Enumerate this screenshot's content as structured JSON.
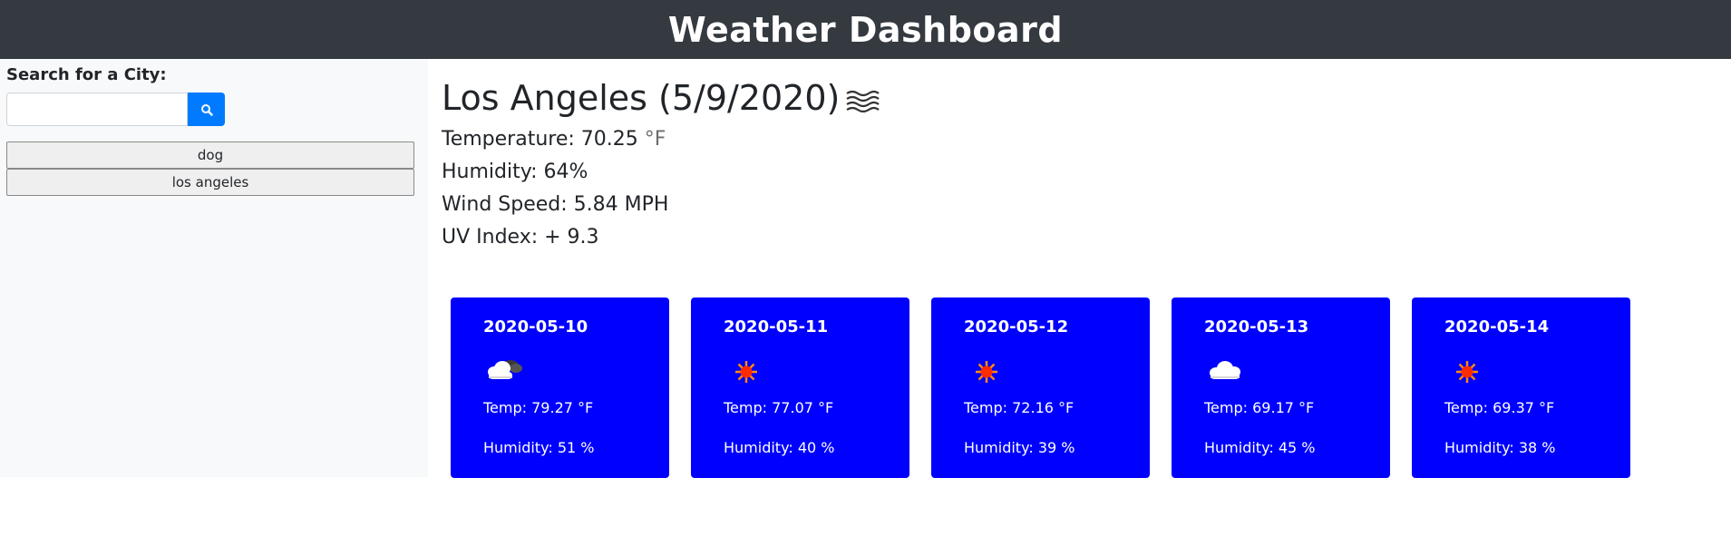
{
  "header": {
    "title": "Weather Dashboard"
  },
  "sidebar": {
    "search_label": "Search for a City:",
    "search_value": "",
    "search_placeholder": "",
    "search_button_icon": "search-icon",
    "history": [
      "dog",
      "los angeles"
    ]
  },
  "current": {
    "title": "Los Angeles (5/9/2020)",
    "icon": "mist-icon",
    "temperature_label": "Temperature: 70.25",
    "temperature_unit": "°F",
    "humidity": "Humidity: 64%",
    "wind": "Wind Speed: 5.84 MPH",
    "uv": "UV Index: + 9.3"
  },
  "forecast": [
    {
      "date": "2020-05-10",
      "icon": "partly-cloudy-icon",
      "temp": "Temp: 79.27 °F",
      "humidity": "Humidity: 51 %"
    },
    {
      "date": "2020-05-11",
      "icon": "sun-icon",
      "temp": "Temp: 77.07 °F",
      "humidity": "Humidity: 40 %"
    },
    {
      "date": "2020-05-12",
      "icon": "sun-icon",
      "temp": "Temp: 72.16 °F",
      "humidity": "Humidity: 39 %"
    },
    {
      "date": "2020-05-13",
      "icon": "cloud-icon",
      "temp": "Temp: 69.17 °F",
      "humidity": "Humidity: 45 %"
    },
    {
      "date": "2020-05-14",
      "icon": "sun-icon",
      "temp": "Temp: 69.37 °F",
      "humidity": "Humidity: 38 %"
    }
  ],
  "colors": {
    "header_bg": "#343a40",
    "sidebar_bg": "#f8f9fa",
    "search_button": "#007bff",
    "forecast_card": "#0000ff"
  }
}
